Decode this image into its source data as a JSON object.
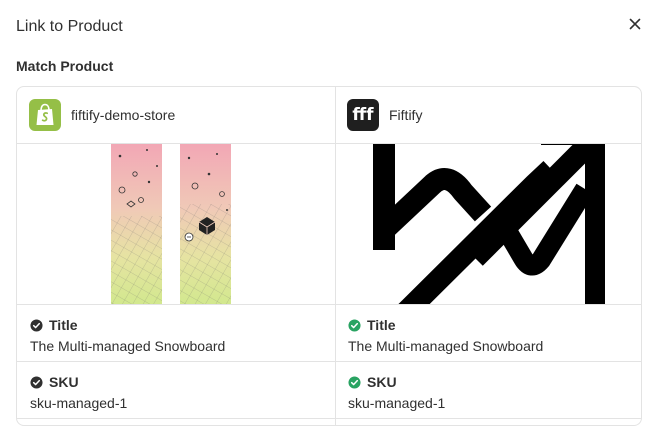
{
  "modal": {
    "title": "Link to Product",
    "close_icon": "close-icon",
    "section_heading": "Match Product"
  },
  "left": {
    "store_name": "fiftify-demo-store",
    "logo_icon": "shopify-bag-icon",
    "image_alt": "snowboard product image",
    "title_label": "Title",
    "title_value": "The Multi-managed Snowboard",
    "title_status": "neutral-check",
    "sku_label": "SKU",
    "sku_value": "sku-managed-1",
    "sku_status": "neutral-check"
  },
  "right": {
    "store_name": "Fiftify",
    "logo_text": "fff",
    "image_alt": "fiftify logo image",
    "title_label": "Title",
    "title_value": "The Multi-managed Snowboard",
    "title_status": "success-check",
    "sku_label": "SKU",
    "sku_value": "sku-managed-1",
    "sku_status": "success-check"
  },
  "colors": {
    "neutral_check": "#303030",
    "success_check": "#29a362",
    "shopify_green": "#95bf47",
    "border": "#e3e3e3"
  }
}
